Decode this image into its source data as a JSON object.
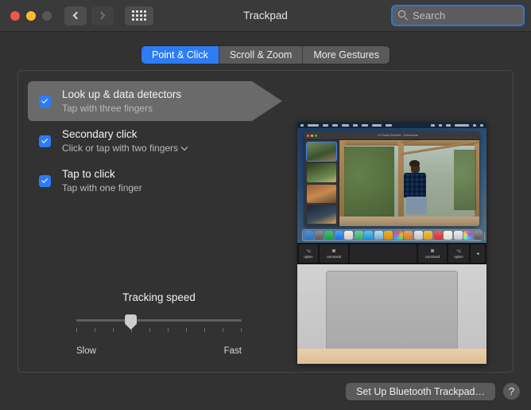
{
  "window": {
    "title": "Trackpad",
    "traffic_lights": [
      "close",
      "minimize",
      "zoom"
    ],
    "nav": {
      "back": "back-button",
      "forward": "forward-button",
      "grid": "show-all-button"
    }
  },
  "search": {
    "placeholder": "Search",
    "value": "",
    "icon": "search-icon"
  },
  "tabs": [
    {
      "label": "Point & Click",
      "active": true
    },
    {
      "label": "Scroll & Zoom",
      "active": false
    },
    {
      "label": "More Gestures",
      "active": false
    }
  ],
  "options": [
    {
      "title": "Look up & data detectors",
      "subtitle": "Tap with three fingers",
      "checked": true,
      "selected": true,
      "has_dropdown": false
    },
    {
      "title": "Secondary click",
      "subtitle": "Click or tap with two fingers",
      "checked": true,
      "selected": false,
      "has_dropdown": true
    },
    {
      "title": "Tap to click",
      "subtitle": "Tap with one finger",
      "checked": true,
      "selected": false,
      "has_dropdown": false
    }
  ],
  "slider": {
    "label": "Tracking speed",
    "min_label": "Slow",
    "max_label": "Fast",
    "ticks": 10,
    "value_percent": 33
  },
  "preview": {
    "app_window_title": "10 Photos Selected - Greenhouse",
    "thumbnails": [
      "Greenhouse",
      "Outdoors",
      "Workbench",
      "Evening"
    ],
    "selected_thumbnail": 0
  },
  "bottom": {
    "setup_button": "Set Up Bluetooth Trackpad…",
    "help_button": "?"
  },
  "colors": {
    "accent": "#2d7cf6",
    "window_bg": "#323232",
    "titlebar_bg": "#3a3a3a",
    "control_bg": "#5a5a5a",
    "selected_row": "#6a6a6a",
    "text_primary": "#f2f2f2",
    "text_secondary": "#b9b9b9"
  }
}
